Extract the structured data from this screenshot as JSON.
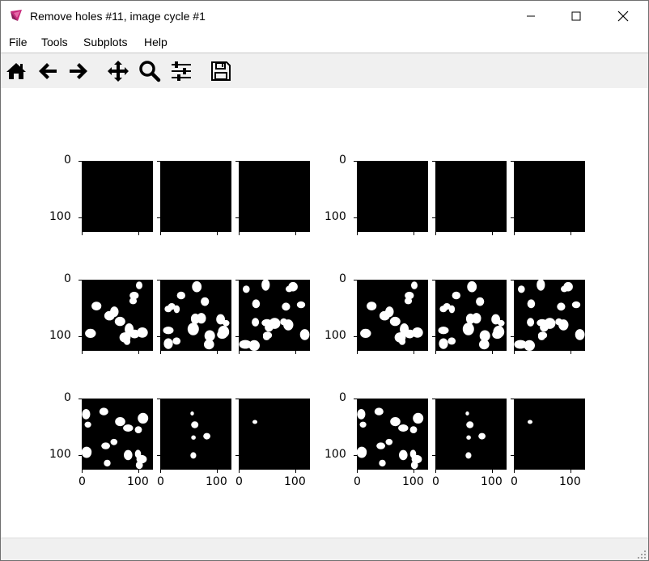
{
  "window": {
    "title": "Remove holes #11, image cycle #1"
  },
  "menu": [
    "File",
    "Tools",
    "Subplots",
    "Help"
  ],
  "toolbar": {
    "tools": [
      {
        "name": "home-icon"
      },
      {
        "name": "back-arrow-icon"
      },
      {
        "name": "forward-arrow-icon"
      },
      {
        "name": "pan-icon"
      },
      {
        "name": "zoom-icon"
      },
      {
        "name": "configure-subplots-icon"
      },
      {
        "name": "save-icon"
      }
    ]
  },
  "figure": {
    "ytick_labels": [
      "0",
      "100"
    ],
    "xtick_labels": [
      "0",
      "100"
    ]
  }
}
